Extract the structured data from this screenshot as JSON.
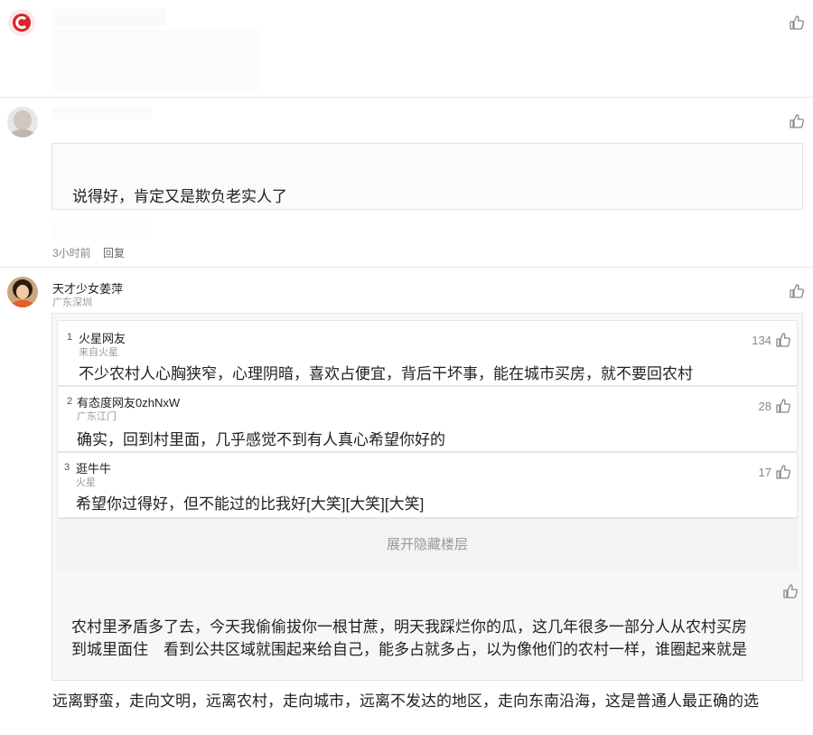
{
  "comments": [
    {
      "avatar": "app-logo-avatar"
    },
    {
      "text": "说得好，肯定又是欺负老实人了",
      "time": "3小时前",
      "reply": "回复"
    },
    {
      "username": "天才少女姜萍",
      "location": "广东深圳",
      "floors": [
        {
          "num": "1",
          "user": "火星网友",
          "loc": "来自火星",
          "text": "不少农村人心胸狭窄，心理阴暗，喜欢占便宜，背后干坏事，能在城市买房，就不要回农村",
          "likes": "134"
        },
        {
          "num": "2",
          "user": "有态度网友0zhNxW",
          "loc": "广东江门",
          "text": "确实，回到村里面，几乎感觉不到有人真心希望你好的",
          "likes": "28"
        },
        {
          "num": "3",
          "user": "逛牛牛",
          "loc": "火星",
          "text": "希望你过得好，但不能过的比我好[大笑][大笑][大笑]",
          "likes": "17"
        }
      ],
      "expand_label": "展开隐藏楼层",
      "body_line1": "农村里矛盾多了去，今天我偷偷拔你一根甘蔗，明天我踩烂你的瓜，这几年很多一部分人从农村买房",
      "body_line2": "到城里面住　看到公共区域就围起来给自己，能多占就多占，以为像他们的农村一样，谁圈起来就是",
      "body_line3": "远离野蛮，走向文明，远离农村，走向城市，远离不发达的地区，走向东南沿海，这是普通人最正确的选"
    }
  ],
  "icons": {
    "like": "thumbs-up-icon"
  },
  "colors": {
    "logo_red": "#d9252b",
    "border": "#e3e3e3",
    "muted": "#888888"
  }
}
